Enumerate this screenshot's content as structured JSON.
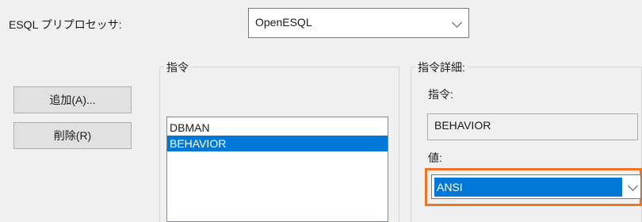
{
  "preprocessor": {
    "label": "ESQL プリプロセッサ:",
    "value": "OpenESQL"
  },
  "buttons": {
    "add": "追加(A)...",
    "remove": "削除(R)"
  },
  "directive_group": {
    "title": "指令",
    "items": [
      "DBMAN",
      "BEHAVIOR"
    ],
    "selected_index": 1
  },
  "detail_group": {
    "title": "指令詳細:",
    "directive_label": "指令:",
    "directive_value": "BEHAVIOR",
    "value_label": "値:",
    "value": "ANSI"
  },
  "colors": {
    "selection": "#0078d7",
    "highlight": "#ee7622"
  }
}
